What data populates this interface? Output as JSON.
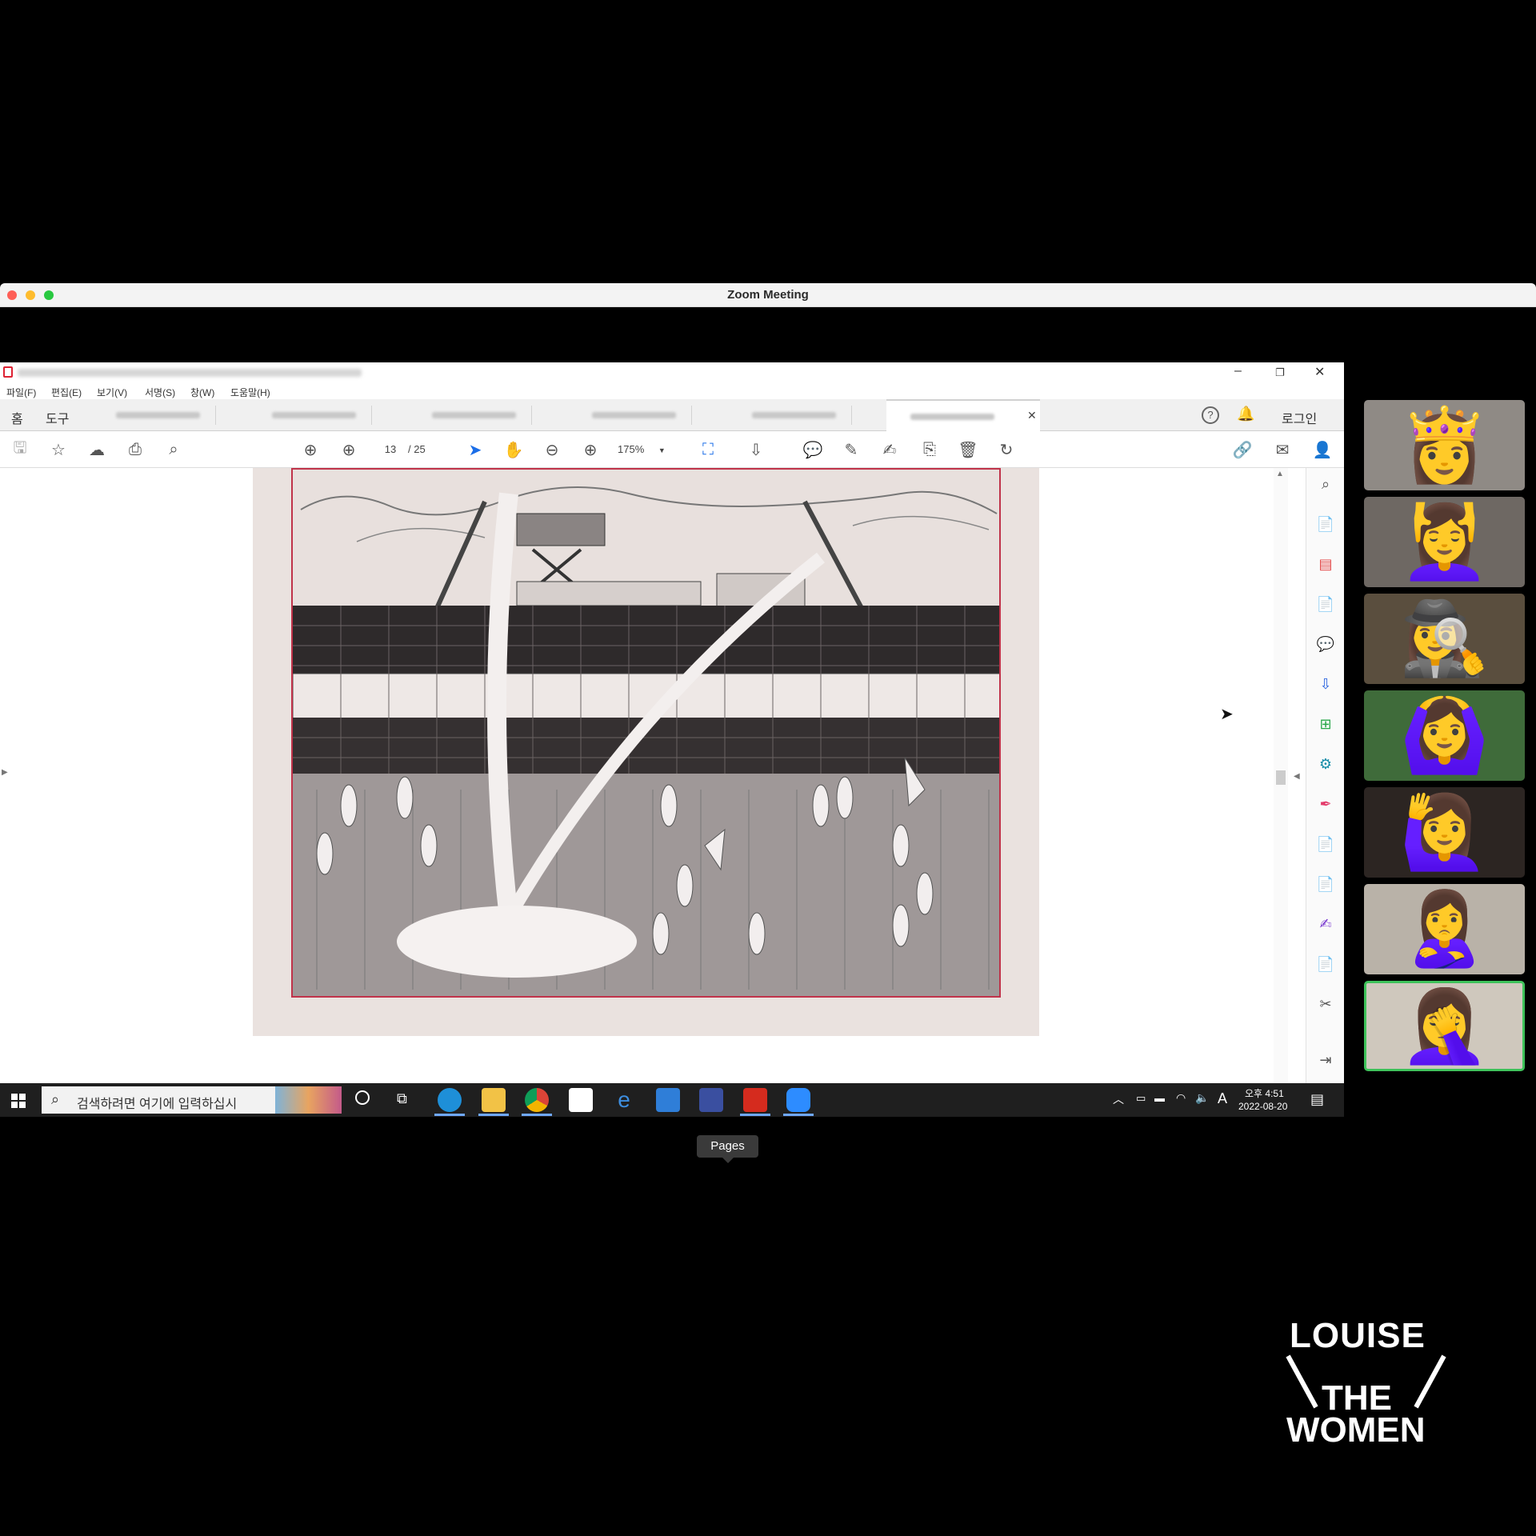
{
  "zoom": {
    "title": "Zoom Meeting",
    "traffic_colors": [
      "#fe5f57",
      "#febc2e",
      "#28c840"
    ]
  },
  "acrobat": {
    "menu": [
      "파일(F)",
      "편집(E)",
      "보기(V)",
      "서명(S)",
      "창(W)",
      "도움말(H)"
    ],
    "tabs": {
      "home": "홈",
      "tools": "도구",
      "login": "로그인"
    },
    "page_current": "13",
    "page_total": "/ 25",
    "zoom_level": "175%"
  },
  "taskbar": {
    "search_placeholder": "검색하려면 여기에 입력하십시",
    "time": "오후 4:51",
    "date": "2022-08-20",
    "ime": "A"
  },
  "tooltip": "Pages",
  "participants": [
    {
      "emoji": "👸",
      "bg": "#8f8a85"
    },
    {
      "emoji": "💆‍♀️",
      "bg": "#6e6863"
    },
    {
      "emoji": "🕵️‍♀️",
      "bg": "#5a4e3e"
    },
    {
      "emoji": "🙆‍♀️",
      "bg": "#3f6b3a"
    },
    {
      "emoji": "🙋‍♀️",
      "bg": "#2c2522"
    },
    {
      "emoji": "🙎‍♀️",
      "bg": "#b9b2a8"
    },
    {
      "emoji": "🤦‍♀️",
      "bg": "#cfc8bd"
    }
  ],
  "logo": {
    "line1": "LOUISE",
    "line2": "THE",
    "line3": "WOMEN"
  }
}
